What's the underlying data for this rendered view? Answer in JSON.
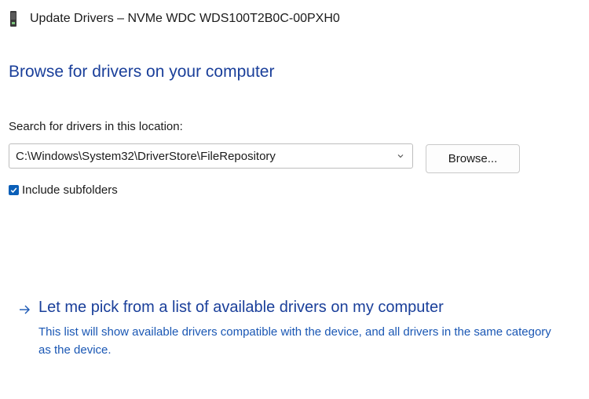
{
  "window": {
    "title": "Update Drivers – NVMe WDC WDS100T2B0C-00PXH0",
    "icon": "drive-icon"
  },
  "heading": "Browse for drivers on your computer",
  "search": {
    "label": "Search for drivers in this location:",
    "path_value": "C:\\Windows\\System32\\DriverStore\\FileRepository",
    "browse_label": "Browse..."
  },
  "include_subfolders": {
    "label": "Include subfolders",
    "checked": true
  },
  "pick_option": {
    "title": "Let me pick from a list of available drivers on my computer",
    "description": "This list will show available drivers compatible with the device, and all drivers in the same category as the device."
  },
  "colors": {
    "heading_blue": "#1a3f9a",
    "link_blue": "#1a57b4",
    "checkbox_blue": "#0a5fb8"
  }
}
